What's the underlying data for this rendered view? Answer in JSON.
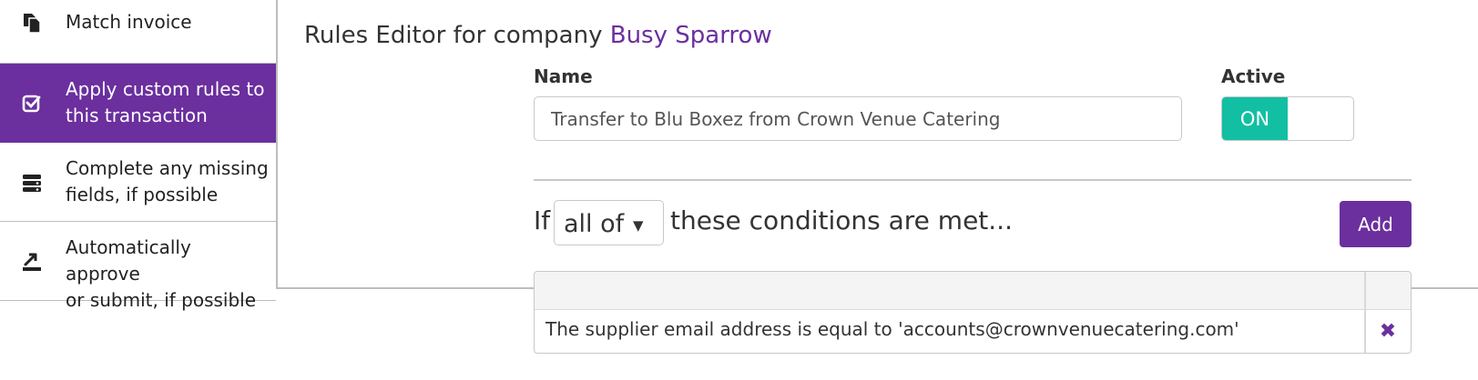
{
  "sidebar": {
    "items": [
      {
        "label_lines": [
          "Match invoice"
        ],
        "icon": "documents-icon",
        "active": false
      },
      {
        "label_lines": [
          "Apply custom rules to",
          "this transaction"
        ],
        "icon": "checkbox-icon",
        "active": true
      },
      {
        "label_lines": [
          "Complete any missing",
          "fields, if possible"
        ],
        "icon": "stacked-fields-icon",
        "active": false
      },
      {
        "label_lines": [
          "Automatically approve",
          "or submit, if possible"
        ],
        "icon": "approve-arrow-icon",
        "active": false
      }
    ]
  },
  "editor": {
    "title_prefix": "Rules Editor for company",
    "company": "Busy Sparrow",
    "name_label": "Name",
    "name_value": "Transfer to Blu Boxez from Crown Venue Catering",
    "active_label": "Active",
    "active_state": "ON",
    "condition": {
      "if_word": "If",
      "selected": "all of",
      "caret": "▼",
      "suffix": "these conditions are met...",
      "add_label": "Add"
    },
    "rules": [
      {
        "text": "The supplier email address is equal to 'accounts@crownvenuecatering.com'",
        "delete_icon": "✖"
      }
    ]
  },
  "colors": {
    "accent": "#6b2f9e",
    "toggle_on": "#12bfa3"
  }
}
